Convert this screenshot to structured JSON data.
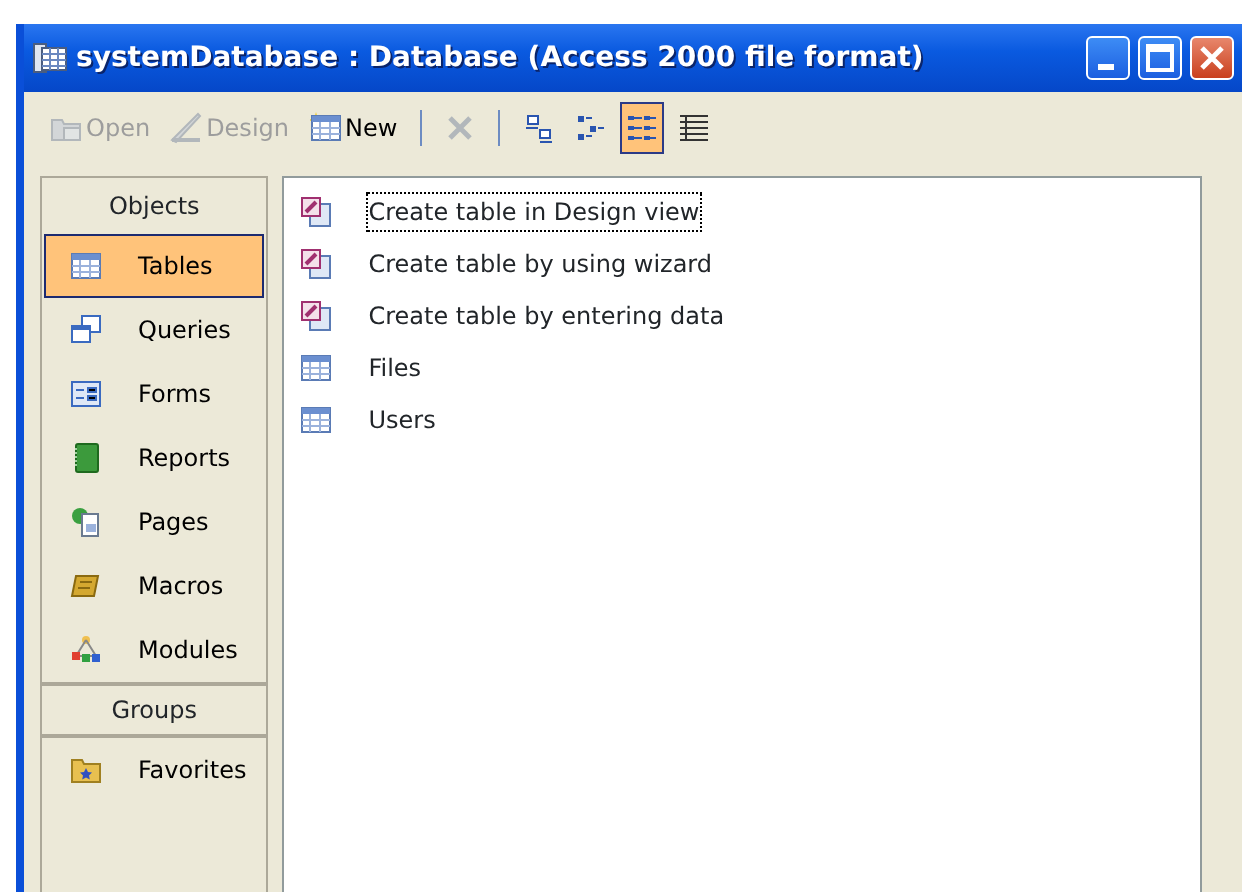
{
  "window": {
    "title": "systemDatabase : Database (Access 2000 file format)"
  },
  "toolbar": [
    {
      "kind": "open",
      "label": "Open",
      "disabled": true,
      "selected": false
    },
    {
      "kind": "design",
      "label": "Design",
      "disabled": true,
      "selected": false
    },
    {
      "kind": "new",
      "label": "New",
      "disabled": false,
      "selected": false
    },
    {
      "kind": "separator"
    },
    {
      "kind": "delete",
      "disabled": true,
      "selected": false
    },
    {
      "kind": "separator"
    },
    {
      "kind": "largeicons",
      "disabled": false,
      "selected": false
    },
    {
      "kind": "smallicons",
      "disabled": false,
      "selected": false
    },
    {
      "kind": "list",
      "disabled": false,
      "selected": true
    },
    {
      "kind": "details",
      "disabled": false,
      "selected": false
    }
  ],
  "sidebar": {
    "sections": [
      {
        "label": "Objects",
        "items": [
          {
            "kind": "table",
            "label": "Tables",
            "selected": true
          },
          {
            "kind": "query",
            "label": "Queries",
            "selected": false
          },
          {
            "kind": "form",
            "label": "Forms",
            "selected": false
          },
          {
            "kind": "report",
            "label": "Reports",
            "selected": false
          },
          {
            "kind": "page",
            "label": "Pages",
            "selected": false
          },
          {
            "kind": "macro",
            "label": "Macros",
            "selected": false
          },
          {
            "kind": "module",
            "label": "Modules",
            "selected": false
          }
        ]
      },
      {
        "label": "Groups",
        "items": [
          {
            "kind": "favorites",
            "label": "Favorites",
            "selected": false
          }
        ]
      }
    ]
  },
  "objects": [
    {
      "kind": "shortcut",
      "label": "Create table in Design view",
      "focused": true
    },
    {
      "kind": "shortcut",
      "label": "Create table by using wizard",
      "focused": false
    },
    {
      "kind": "shortcut",
      "label": "Create table by entering data",
      "focused": false
    },
    {
      "kind": "table",
      "label": "Files",
      "focused": false
    },
    {
      "kind": "table",
      "label": "Users",
      "focused": false
    }
  ]
}
